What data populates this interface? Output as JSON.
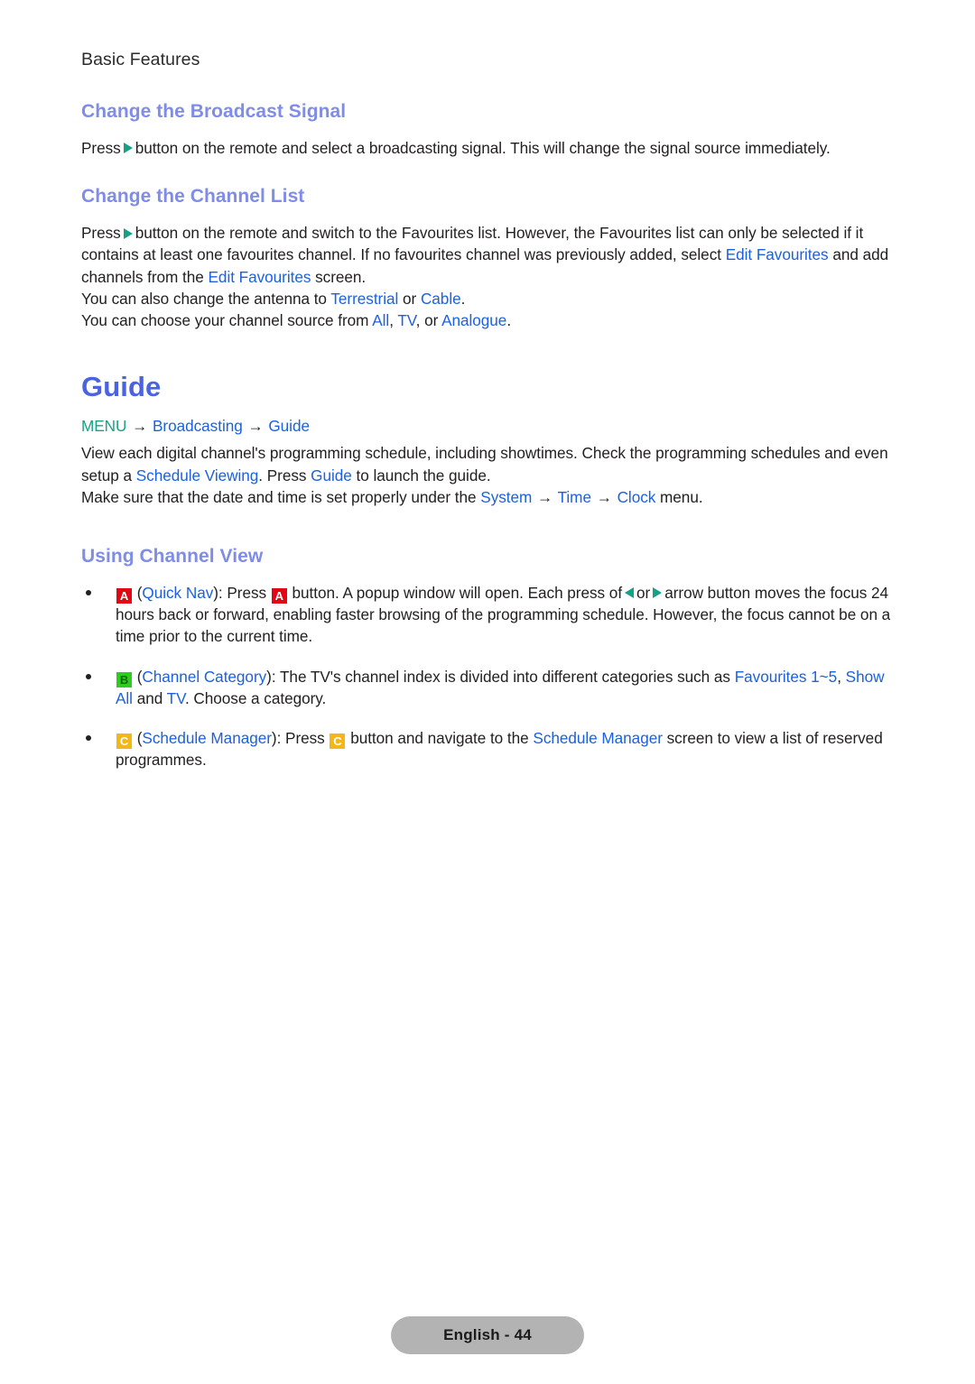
{
  "document": {
    "breadcrumb": "Basic Features",
    "footer_label": "English - 44"
  },
  "colors": {
    "subheading": "#7f8ce8",
    "heading": "#4a63e0",
    "link": "#1b62e0",
    "menu_teal": "#1aa185",
    "arrow_teal": "#16a085",
    "key_a_bg": "#e30613",
    "key_b_bg": "#2ecc1f",
    "key_c_bg": "#f5b618",
    "footer_bg": "#b3b3b3",
    "body_text": "#231f20"
  },
  "sections": {
    "broadcast_signal": {
      "heading": "Change the Broadcast Signal",
      "para_1_a": "Press",
      "para_1_b": "button on the remote and select a broadcasting signal. This will change the signal source immediately."
    },
    "channel_list": {
      "heading": "Change the Channel List",
      "p1_a": "Press",
      "p1_b": "button on the remote and switch to the Favourites list. However, the Favourites list can only be selected if it contains at least one favourites channel. If no favourites channel was previously added, select",
      "p1_link_1": "Edit Favourites",
      "p1_c": "and add channels from the",
      "p1_link_2": "Edit Favourites",
      "p1_d": "screen.",
      "p2_a": "You can also change the antenna to",
      "p2_link_1": "Terrestrial",
      "p2_b": "or",
      "p2_link_2": "Cable",
      "p2_c": ".",
      "p3_a": "You can choose your channel source from",
      "p3_link_1": "All",
      "p3_sep_1": ",",
      "p3_link_2": "TV",
      "p3_b": ", or",
      "p3_link_3": "Analogue",
      "p3_c": "."
    },
    "guide": {
      "heading": "Guide",
      "menu_path": {
        "menu": "MENU",
        "arrow_1": "→",
        "item_1": "Broadcasting",
        "arrow_2": "→",
        "item_2": "Guide"
      },
      "p1_a": "View each digital channel's programming schedule, including showtimes. Check the programming schedules and even setup a",
      "p1_link_1": "Schedule Viewing",
      "p1_b": ". Press",
      "p1_link_2": "Guide",
      "p1_c": "to launch the guide.",
      "p2_a": "Make sure that the date and time is set properly under the",
      "p2_link_1": "System",
      "p2_arrow_1": "→",
      "p2_link_2": "Time",
      "p2_arrow_2": "→",
      "p2_link_3": "Clock",
      "p2_b": "menu."
    },
    "channel_view": {
      "heading": "Using Channel View",
      "bullets": [
        {
          "key": "A",
          "key_color": "#e30613",
          "t_a": "(",
          "link_1": "Quick Nav",
          "t_b": "): Press",
          "key_inline": "A",
          "t_c": "button. A popup window will open. Each press of",
          "t_d": "or",
          "t_e": "arrow button moves the focus 24 hours back or forward, enabling faster browsing of the programming schedule. However, the focus cannot be on a time prior to the current time."
        },
        {
          "key": "B",
          "key_color": "#2ecc1f",
          "t_a": "(",
          "link_1": "Channel Category",
          "t_b": "): The TV's channel index is divided into different categories such as",
          "link_2": "Favourites 1~5",
          "t_c": ",",
          "link_3": "Show All",
          "t_d": "and",
          "link_4": "TV",
          "t_e": ". Choose a category."
        },
        {
          "key": "C",
          "key_color": "#f5b618",
          "t_a": "(",
          "link_1": "Schedule Manager",
          "t_b": "): Press",
          "key_inline": "C",
          "t_c": "button and navigate to the",
          "link_2": "Schedule Manager",
          "t_d": "screen to view a list of reserved programmes."
        }
      ]
    }
  }
}
